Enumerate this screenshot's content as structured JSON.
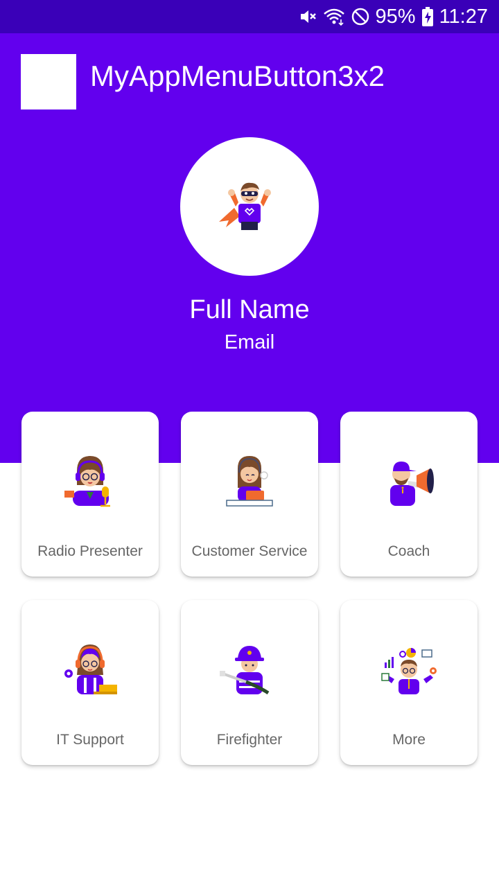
{
  "status_bar": {
    "battery": "95%",
    "time": "11:27",
    "icons": [
      "mute-icon",
      "wifi-icon",
      "blocked-icon",
      "battery-charging-icon"
    ]
  },
  "app_bar": {
    "title": "MyAppMenuButton3x2"
  },
  "profile": {
    "name": "Full Name",
    "email": "Email",
    "avatar_icon": "superhero-avatar-icon"
  },
  "menu": {
    "items": [
      {
        "label": "Radio Presenter",
        "icon": "radio-presenter-icon"
      },
      {
        "label": "Customer Service",
        "icon": "customer-service-icon"
      },
      {
        "label": "Coach",
        "icon": "coach-icon"
      },
      {
        "label": "IT Support",
        "icon": "it-support-icon"
      },
      {
        "label": "Firefighter",
        "icon": "firefighter-icon"
      },
      {
        "label": "More",
        "icon": "more-icon"
      }
    ]
  },
  "colors": {
    "primary": "#6200ee",
    "status_bar": "#3a00b8",
    "card": "#ffffff",
    "card_text": "#666666",
    "accent_orange": "#f06a2e"
  }
}
